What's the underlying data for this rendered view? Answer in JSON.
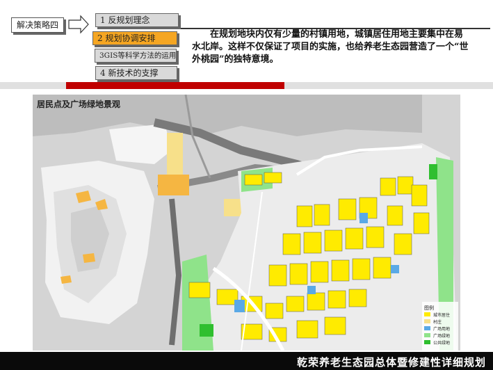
{
  "header": {
    "strategy_label": "解决策略四",
    "steps": [
      {
        "label": "1  反规划理念"
      },
      {
        "label": "2  规划协调安排"
      },
      {
        "label": "3GIS等科学方法的运用"
      },
      {
        "label": "4  新技术的支撑"
      }
    ],
    "description": "在规划地块内仅有少量的村镇用地，城镇居住用地主要集中在易水北岸。这样不仅保证了项目的实施，也给养老生态园营造了一个“世外桃园”的独特意境。"
  },
  "map": {
    "title": "居民点及广场绿地景观",
    "legend": {
      "title": "图例",
      "items": [
        {
          "label": "城市居住",
          "color": "#ffeb00"
        },
        {
          "label": "村庄",
          "color": "#f7e08a"
        },
        {
          "label": "广场用地",
          "color": "#5aa9e6"
        },
        {
          "label": "广场绿地",
          "color": "#8fe38a"
        },
        {
          "label": "公共绿地",
          "color": "#2fbf2f"
        }
      ]
    }
  },
  "footer": {
    "title": "乾荣养老生态园总体暨修建性详细规划"
  },
  "colors": {
    "accent_red": "#c00000",
    "highlight_orange": "#f5a623",
    "footer_bg": "#0a0a0a"
  }
}
